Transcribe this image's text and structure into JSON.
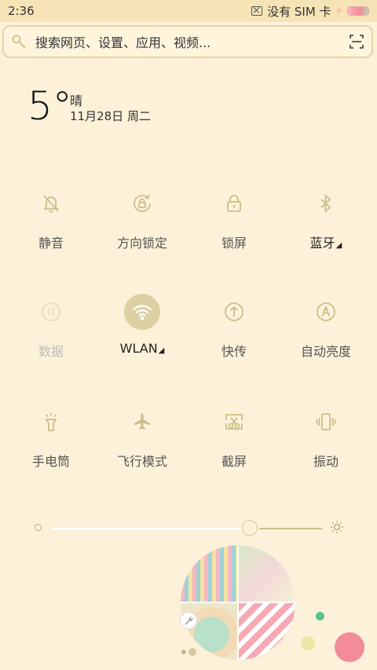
{
  "status_bar": {
    "time": "2:36",
    "carrier": "没有 SIM 卡",
    "icons": [
      "no-sim-icon",
      "charging-bolt-icon",
      "battery-icon"
    ]
  },
  "search": {
    "placeholder": "搜索网页、设置、应用、视频...",
    "icons": [
      "search-icon",
      "scan-icon"
    ]
  },
  "weather": {
    "temperature": "5°",
    "condition": "晴",
    "date": "11月28日 周二"
  },
  "toggles": [
    {
      "label": "静音",
      "icon": "bell-off-icon",
      "active": false
    },
    {
      "label": "方向锁定",
      "icon": "rotation-lock-icon",
      "active": false
    },
    {
      "label": "锁屏",
      "icon": "lock-icon",
      "active": false
    },
    {
      "label": "蓝牙",
      "icon": "bluetooth-icon",
      "active": false,
      "has_more": true
    },
    {
      "label": "数据",
      "icon": "mobile-data-icon",
      "active": false,
      "disabled": true
    },
    {
      "label": "WLAN",
      "icon": "wifi-icon",
      "active": true,
      "has_more": true
    },
    {
      "label": "快传",
      "icon": "quick-transfer-icon",
      "active": false
    },
    {
      "label": "自动亮度",
      "icon": "auto-brightness-icon",
      "active": false
    },
    {
      "label": "手电筒",
      "icon": "flashlight-icon",
      "active": false
    },
    {
      "label": "飞行模式",
      "icon": "airplane-icon",
      "active": false
    },
    {
      "label": "截屏",
      "icon": "screenshot-icon",
      "active": false
    },
    {
      "label": "振动",
      "icon": "vibrate-icon",
      "active": false
    }
  ],
  "brightness": {
    "level": 0.75,
    "icons": [
      "brightness-low-icon",
      "brightness-high-icon"
    ]
  },
  "colors": {
    "background": "#fdf1d9",
    "accent": "#ddd0a3",
    "icon": "#cdbd8b",
    "pink": "#f38b99",
    "green": "#5bc38f"
  }
}
